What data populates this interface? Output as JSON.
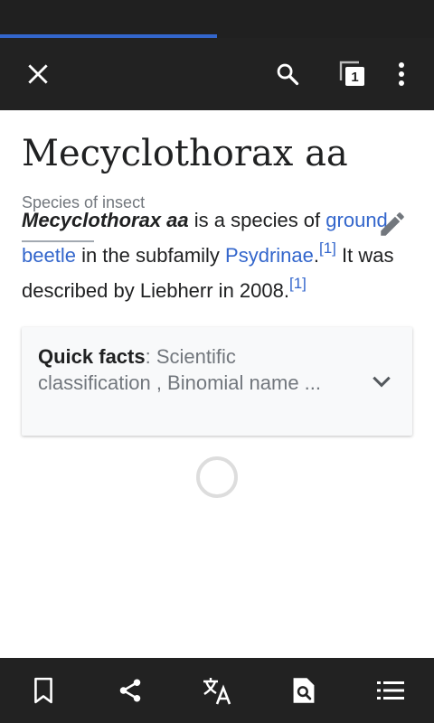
{
  "page_load": {
    "progress_fraction": 0.5
  },
  "toolbar": {
    "icons": [
      "close-icon",
      "search-icon",
      "tabs-icon",
      "overflow-menu-icon"
    ],
    "tab_count": "1"
  },
  "article": {
    "title": "Mecyclothorax aa",
    "description": "Species of insect",
    "intro": {
      "bold_name": "Mecyclothorax aa",
      "text1": " is a species of ",
      "link1": "ground beetle",
      "text2": " in the subfamily ",
      "link2": "Psydrinae",
      "text3": ".",
      "ref1": "[1]",
      "text4": " It was described by Liebherr in 2008.",
      "ref2": "[1]"
    },
    "quick_facts": {
      "label": "Quick facts",
      "summary": ": Scientific classification , Binomial name ..."
    }
  },
  "bottom_bar": {
    "icons": [
      "bookmark-icon",
      "share-icon",
      "translate-icon",
      "find-in-page-icon",
      "contents-icon"
    ]
  },
  "colors": {
    "chrome": "#222222",
    "accent": "#3366cc",
    "text": "#202122",
    "muted": "#72777d"
  }
}
